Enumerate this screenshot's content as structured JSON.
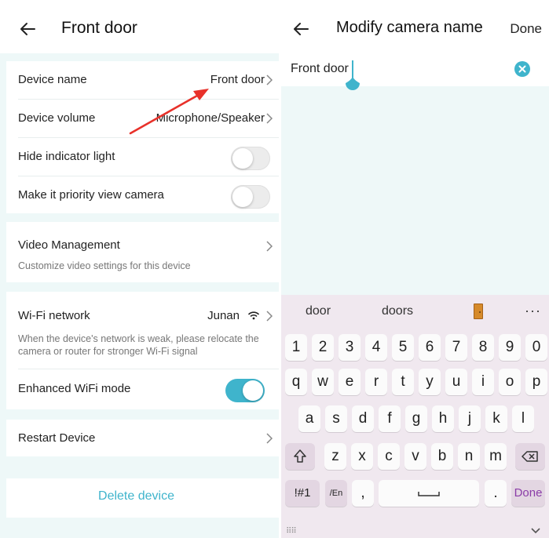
{
  "left": {
    "header": {
      "title": "Front door",
      "back_icon": "arrow-left-icon"
    },
    "settings": {
      "device_name": {
        "label": "Device name",
        "value": "Front door"
      },
      "device_volume": {
        "label": "Device volume",
        "value": "Microphone/Speaker"
      },
      "hide_indicator": {
        "label": "Hide indicator light",
        "on": false
      },
      "priority_view": {
        "label": "Make it priority view camera",
        "on": false
      },
      "video_management": {
        "label": "Video Management",
        "description": "Customize video settings for this device"
      },
      "wifi": {
        "label": "Wi-Fi network",
        "value": "Junan",
        "description_line1": "When the device's network is weak, please relocate the",
        "description_line2": "camera or router for stronger Wi-Fi signal"
      },
      "enhanced_wifi": {
        "label": "Enhanced WiFi mode",
        "on": true
      },
      "restart": {
        "label": "Restart Device"
      }
    },
    "delete_label": "Delete device"
  },
  "right": {
    "header": {
      "title": "Modify camera name",
      "done_label": "Done",
      "back_icon": "arrow-left-icon"
    },
    "name_input": {
      "value": "Front door"
    },
    "keyboard": {
      "suggestions": [
        "door",
        "doors"
      ],
      "suggestion_emoji": "door-emoji",
      "more": "···",
      "row_numbers": [
        "1",
        "2",
        "3",
        "4",
        "5",
        "6",
        "7",
        "8",
        "9",
        "0"
      ],
      "row_1": [
        "q",
        "w",
        "e",
        "r",
        "t",
        "y",
        "u",
        "i",
        "o",
        "p"
      ],
      "row_2": [
        "a",
        "s",
        "d",
        "f",
        "g",
        "h",
        "j",
        "k",
        "l"
      ],
      "row_3": [
        "z",
        "x",
        "c",
        "v",
        "b",
        "n",
        "m"
      ],
      "symbols_label": "!#1",
      "lang_label": "/En",
      "comma": ",",
      "period": ".",
      "done_key": "Done"
    }
  },
  "colors": {
    "accent": "#3fb4cc",
    "annotation_arrow": "#e8312a",
    "panel_bg": "#eef8f8",
    "keyboard_bg": "#f0e8ef"
  }
}
